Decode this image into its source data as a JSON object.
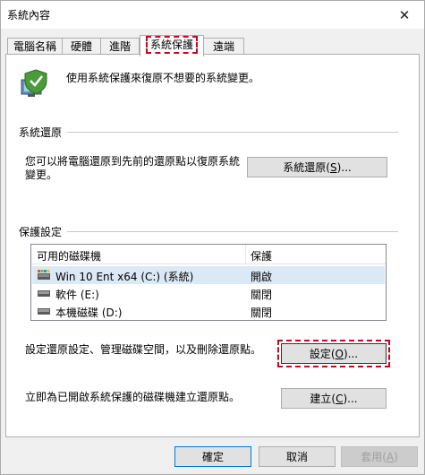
{
  "window": {
    "title": "系統內容",
    "close_symbol": "✕"
  },
  "tabs": [
    {
      "label": "電腦名稱",
      "active": false
    },
    {
      "label": "硬體",
      "active": false
    },
    {
      "label": "進階",
      "active": false
    },
    {
      "label": "系統保護",
      "active": true
    },
    {
      "label": "遠端",
      "active": false
    }
  ],
  "intro": "使用系統保護來復原不想要的系統變更。",
  "system_restore": {
    "group_title": "系統還原",
    "description": "您可以將電腦還原到先前的還原點以復原系統變更。",
    "button": {
      "prefix": "系統還原(",
      "mnemonic": "S",
      "suffix": ")..."
    }
  },
  "protection": {
    "group_title": "保護設定",
    "columns": [
      "可用的磁碟機",
      "保護"
    ],
    "drives": [
      {
        "name": "Win 10 Ent x64 (C:) (系統)",
        "status": "開啟",
        "icon": "system-drive-icon",
        "selected": true
      },
      {
        "name": "軟件 (E:)",
        "status": "關閉",
        "icon": "drive-icon",
        "selected": false
      },
      {
        "name": "本機磁碟 (D:)",
        "status": "關閉",
        "icon": "drive-icon",
        "selected": false
      }
    ],
    "configure_text": "設定還原設定、管理磁碟空間，以及刪除還原點。",
    "configure_button": {
      "prefix": "設定(",
      "mnemonic": "O",
      "suffix": ")..."
    },
    "create_text": "立即為已開啟系統保護的磁碟機建立還原點。",
    "create_button": {
      "prefix": "建立(",
      "mnemonic": "C",
      "suffix": ")..."
    }
  },
  "footer": {
    "ok": "確定",
    "cancel": "取消",
    "apply": {
      "prefix": "套用(",
      "mnemonic": "A",
      "suffix": ")"
    }
  },
  "colors": {
    "highlight_dashed": "#d0021b",
    "selection": "#dbe9f6",
    "primary_border": "#0078d7"
  }
}
